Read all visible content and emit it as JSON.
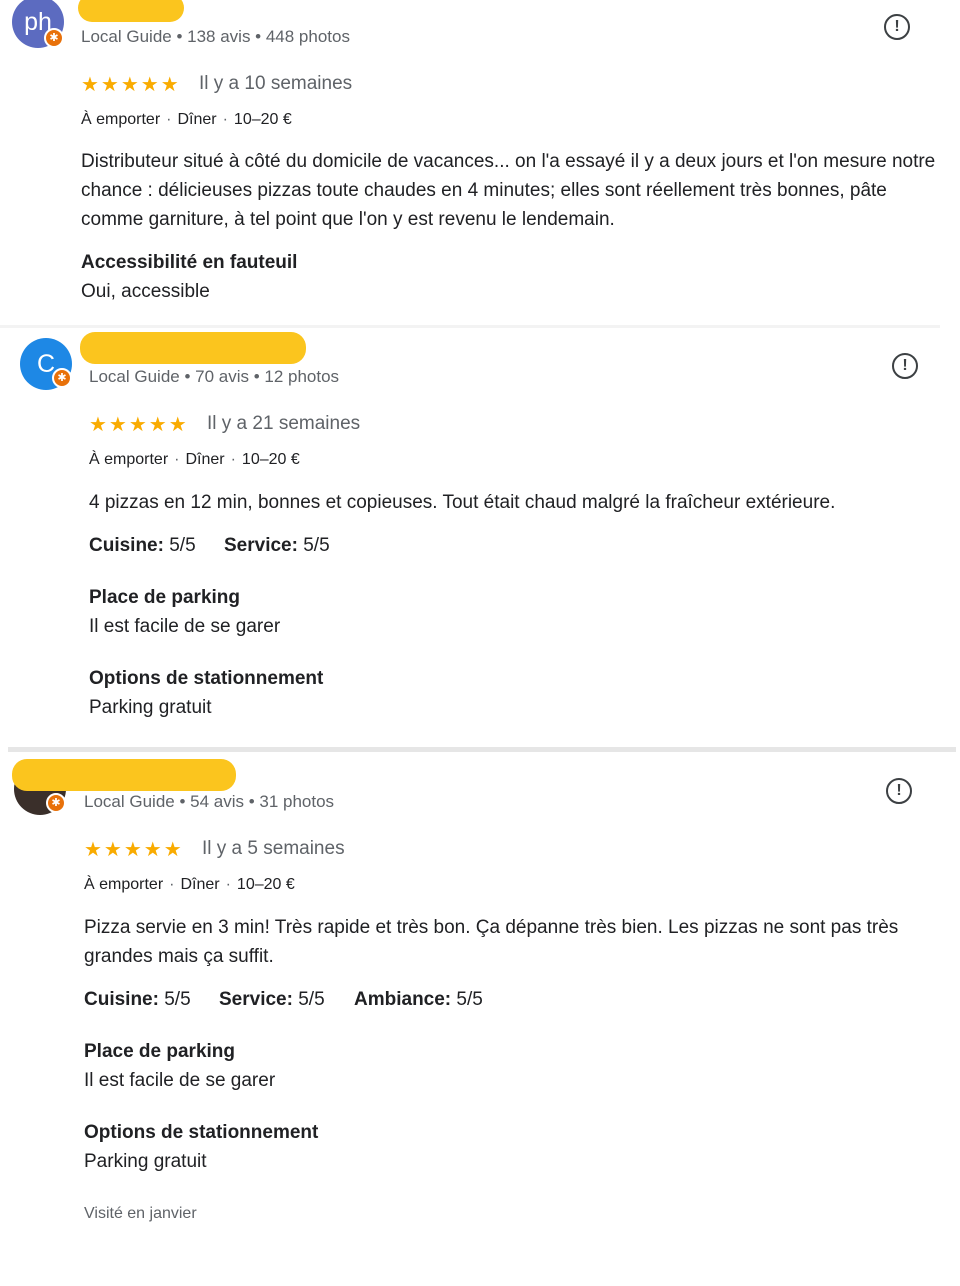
{
  "reviews": [
    {
      "avatar_letter": "ph",
      "avatar_color": "#5c6bc0",
      "meta": "Local Guide • 138 avis • 448 photos",
      "stars": "★★★★★",
      "time": "Il y a 10 semaines",
      "tags": [
        "À emporter",
        "Dîner",
        "10–20 €"
      ],
      "text": "Distributeur situé à côté du domicile de vacances... on l'a essayé il y a deux jours et l'on mesure notre chance : délicieuses pizzas toute chaudes en 4 minutes; elles sont réellement très bonnes, pâte comme garniture, à tel point que l'on y est revenu le lendemain.",
      "sections": [
        {
          "title": "Accessibilité en fauteuil",
          "value": "Oui, accessible"
        }
      ]
    },
    {
      "avatar_letter": "C",
      "avatar_color": "#1e88e5",
      "meta": "Local Guide • 70 avis • 12 photos",
      "stars": "★★★★★",
      "time": "Il y a 21 semaines",
      "tags": [
        "À emporter",
        "Dîner",
        "10–20 €"
      ],
      "text": "4 pizzas en 12 min, bonnes et copieuses. Tout était chaud malgré la fraîcheur extérieure.",
      "ratings": [
        {
          "label": "Cuisine:",
          "value": "5/5"
        },
        {
          "label": "Service:",
          "value": "5/5"
        }
      ],
      "sections": [
        {
          "title": "Place de parking",
          "value": "Il est facile de se garer"
        },
        {
          "title": "Options de stationnement",
          "value": "Parking gratuit"
        }
      ]
    },
    {
      "avatar_letter": "",
      "avatar_color": "#3a2f2a",
      "meta": "Local Guide • 54 avis • 31 photos",
      "stars": "★★★★★",
      "time": "Il y a 5 semaines",
      "tags": [
        "À emporter",
        "Dîner",
        "10–20 €"
      ],
      "text": "Pizza servie en 3 min! Très rapide et très bon. Ça dépanne très bien. Les pizzas ne sont pas très grandes mais ça suffit.",
      "ratings": [
        {
          "label": "Cuisine:",
          "value": "5/5"
        },
        {
          "label": "Service:",
          "value": "5/5"
        },
        {
          "label": "Ambiance:",
          "value": "5/5"
        }
      ],
      "sections": [
        {
          "title": "Place de parking",
          "value": "Il est facile de se garer"
        },
        {
          "title": "Options de stationnement",
          "value": "Parking gratuit"
        }
      ],
      "visited": "Visité en janvier"
    }
  ],
  "icons": {
    "flag": "report-icon",
    "badge": "local-guide-badge-icon",
    "star": "star-icon"
  },
  "colors": {
    "star": "#f9ab00",
    "redaction": "#fbc51e",
    "badge": "#e8710a"
  }
}
